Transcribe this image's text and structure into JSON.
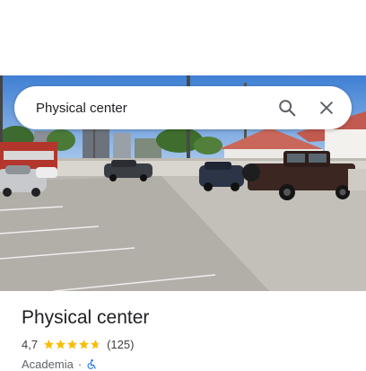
{
  "search": {
    "query": "Physical center",
    "search_icon": "search-icon",
    "close_icon": "close-icon"
  },
  "photo": {
    "subject": "parking-lot-photo"
  },
  "place": {
    "title": "Physical center",
    "rating": "4,7",
    "rating_fraction": 0.94,
    "star_color": "#fbbc04",
    "star_empty_color": "#dadce0",
    "reviews": "(125)",
    "category": "Academia",
    "separator": "·",
    "accessibility_icon": "wheelchair-accessible-icon",
    "accessibility_color": "#1a73e8"
  }
}
